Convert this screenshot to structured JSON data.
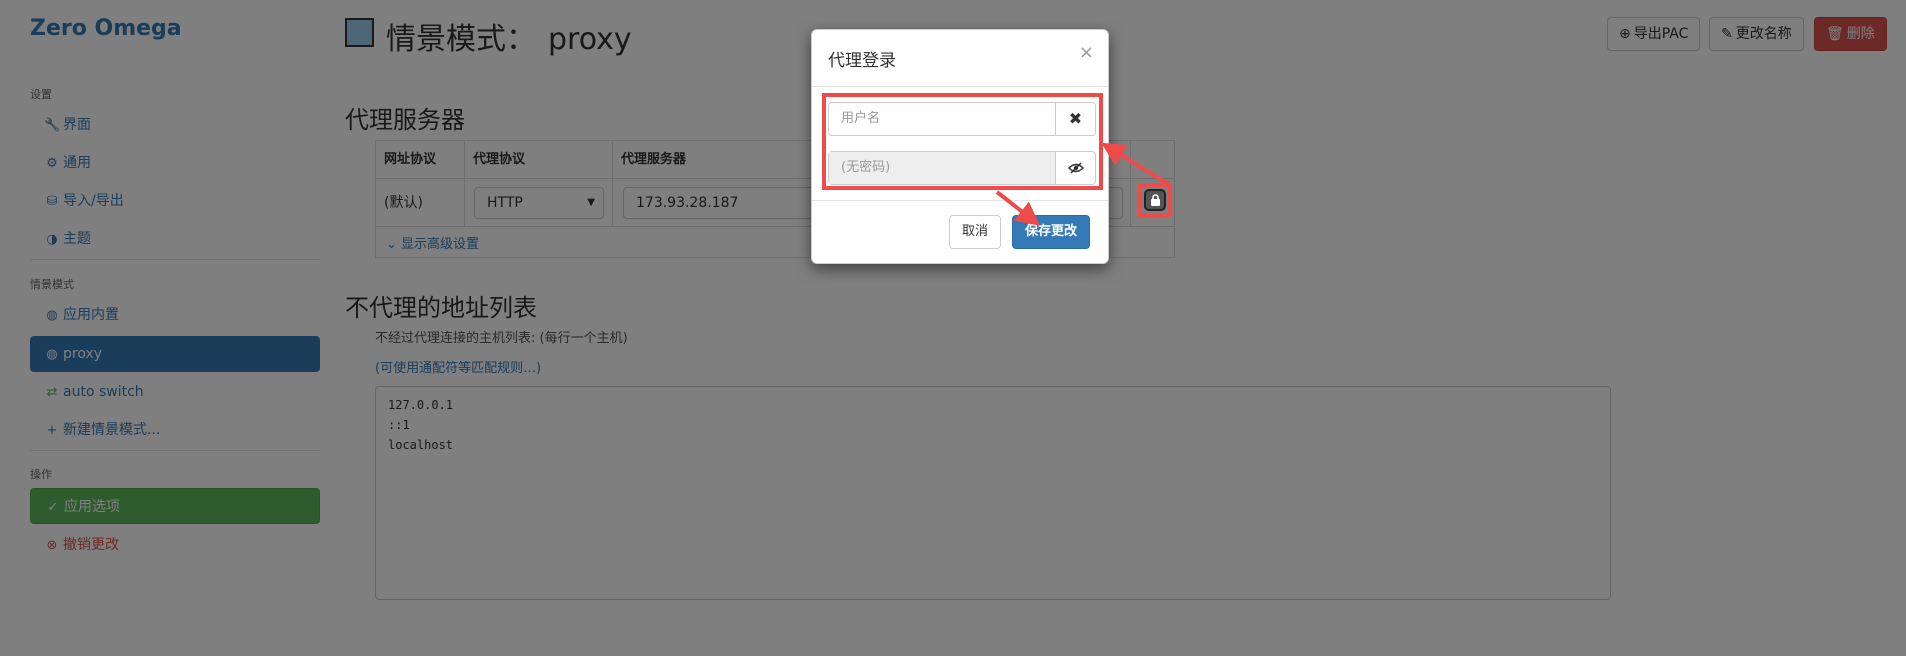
{
  "sidebar": {
    "brand": "Zero Omega",
    "sections": [
      {
        "header": "设置"
      },
      {
        "header": "情景模式"
      },
      {
        "header": "操作"
      }
    ],
    "settings_items": [
      {
        "icon": "wrench-icon",
        "glyph": "🔧",
        "label": "界面"
      },
      {
        "icon": "gear-icon",
        "glyph": "⚙",
        "label": "通用"
      },
      {
        "icon": "import-export-icon",
        "glyph": "⛁",
        "label": "导入/导出"
      },
      {
        "icon": "theme-icon",
        "glyph": "◑",
        "label": "主题"
      }
    ],
    "profile_items": [
      {
        "icon": "globe-icon",
        "glyph": "◍",
        "label": "应用内置"
      },
      {
        "icon": "globe-icon",
        "glyph": "◍",
        "label": "proxy",
        "active": true
      },
      {
        "icon": "switch-icon",
        "glyph": "⇄",
        "label": "auto switch"
      },
      {
        "icon": "plus-icon",
        "glyph": "+",
        "label": "新建情景模式..."
      }
    ],
    "action_items": [
      {
        "icon": "check-circle-icon",
        "glyph": "✓",
        "label": "应用选项"
      },
      {
        "icon": "x-circle-icon",
        "glyph": "⊗",
        "label": "撤销更改"
      }
    ]
  },
  "header": {
    "title_prefix": "情景模式：",
    "profile_name": "proxy",
    "profile_color": "#99ccee",
    "export_pac": "导出PAC",
    "rename": "更改名称",
    "delete": "删除"
  },
  "proxy_section": {
    "title": "代理服务器",
    "columns": [
      "网址协议",
      "代理协议",
      "代理服务器"
    ],
    "row": {
      "scheme": "(默认)",
      "protocol": "HTTP",
      "server": "173.93.28.187"
    },
    "advanced_link": "显示高级设置"
  },
  "bypass_section": {
    "title": "不代理的地址列表",
    "help": "不经过代理连接的主机列表: (每行一个主机)",
    "wildcard_link": "(可使用通配符等匹配规则…)",
    "entries": [
      "127.0.0.1",
      "::1",
      "localhost"
    ]
  },
  "modal": {
    "title": "代理登录",
    "close": "×",
    "username_placeholder": "用户名",
    "password_placeholder": "(无密码)",
    "clear_glyph": "✖",
    "cancel": "取消",
    "save": "保存更改"
  },
  "colors": {
    "primary": "#337ab7",
    "success": "#5cb85c",
    "danger": "#d9534f",
    "annotation": "#ef4b4b"
  }
}
